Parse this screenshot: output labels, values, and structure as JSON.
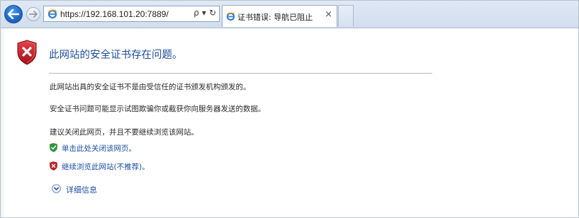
{
  "browser": {
    "address_url": "https://192.168.101.20:7889/",
    "search_symbol": "ρ",
    "dropdown_symbol": "▾",
    "refresh_symbol": "↻",
    "tab_title": "证书错误: 导航已阻止",
    "tab_close_symbol": "×"
  },
  "page": {
    "headline": "此网站的安全证书存在问题。",
    "message_1": "此网站出具的安全证书不是由受信任的证书颁发机构颁发的。",
    "message_2": "安全证书问题可能显示试图欺骗你或截获你向服务器发送的数据。",
    "message_3": "建议关闭此网页，并且不要继续浏览该网站。",
    "close_link": "单击此处关闭该网页。",
    "continue_link": "继续浏览此网站(不推荐)。",
    "details_link": "详细信息"
  },
  "colors": {
    "link": "#1c4fa0",
    "headline": "#1f4e9c",
    "shield_red": "#c8202a",
    "shield_green": "#2e9a3a",
    "back_button": "#1f66c2"
  },
  "icons": {
    "back": "back-arrow-icon",
    "forward": "forward-arrow-icon",
    "page": "ie-page-icon",
    "error": "red-shield-x-icon",
    "safe": "green-shield-check-icon",
    "expand": "chevron-circle-down-icon"
  }
}
